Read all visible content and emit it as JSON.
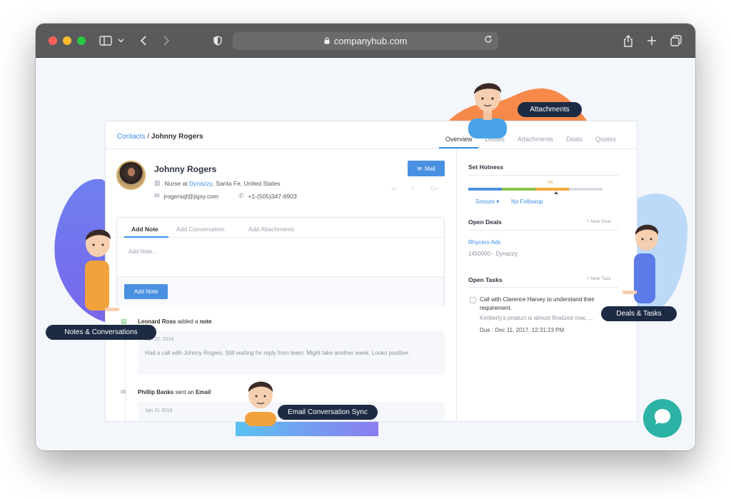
{
  "browser": {
    "url": "companyhub.com"
  },
  "breadcrumb": {
    "parent": "Contacts",
    "separator": "/",
    "current": "Johnny Rogers"
  },
  "tabs": [
    "Overview",
    "Details",
    "Attachments",
    "Deals",
    "Quotes"
  ],
  "contact": {
    "name": "Johnny Rogers",
    "job_title": "Nurse",
    "at_word": "at",
    "company": "Dynazzy",
    "location": ", Santa Fe, United States",
    "email": "jrogersqf@jigsy.com",
    "phone": "+1-(505)347-6903",
    "mail_button": "Mail",
    "social": [
      "in",
      "t",
      "G+"
    ]
  },
  "note_box": {
    "tabs": [
      "Add Note",
      "Add Conversation",
      "Add Attachments"
    ],
    "placeholder": "Add Note...",
    "button": "Add Note"
  },
  "feed": [
    {
      "user": "Leonard Ross",
      "action": "added a",
      "object": "note",
      "date": "Jan 22, 2016",
      "text": "Had a call with Johnny Rogers. Still waiting for reply from team. Might take another week. Looks positive."
    },
    {
      "user": "Phillip Banks",
      "action": "sent an",
      "object": "Email",
      "date": "Jan 21 2016"
    }
  ],
  "hotness": {
    "title": "Set Hotness",
    "label": "Hot",
    "colors": [
      "#4a90e2",
      "#8bc34a",
      "#f5a742",
      "#d9dde3"
    ],
    "snooze": "Snooze ▾",
    "no_followup": "No Followup"
  },
  "open_deals": {
    "title": "Open Deals",
    "new_link": "+ New Deal",
    "deal_name": "Rhycero Ads",
    "deal_sub": "1450000 - Dynazzy"
  },
  "open_tasks": {
    "title": "Open Tasks",
    "new_link": "+ New Task",
    "task_title": "Call with Clarence Harvey to understand their requirement.",
    "task_desc": "Kimberly's product is almost finalized now, ...",
    "task_due": "Due : Dec 11, 2017, 12:31:23 PM"
  },
  "callouts": {
    "attachments": "Attachments",
    "notes": "Notes & Conversations",
    "deals_tasks": "Deals & Tasks",
    "email_sync": "Email Conversation Sync"
  }
}
